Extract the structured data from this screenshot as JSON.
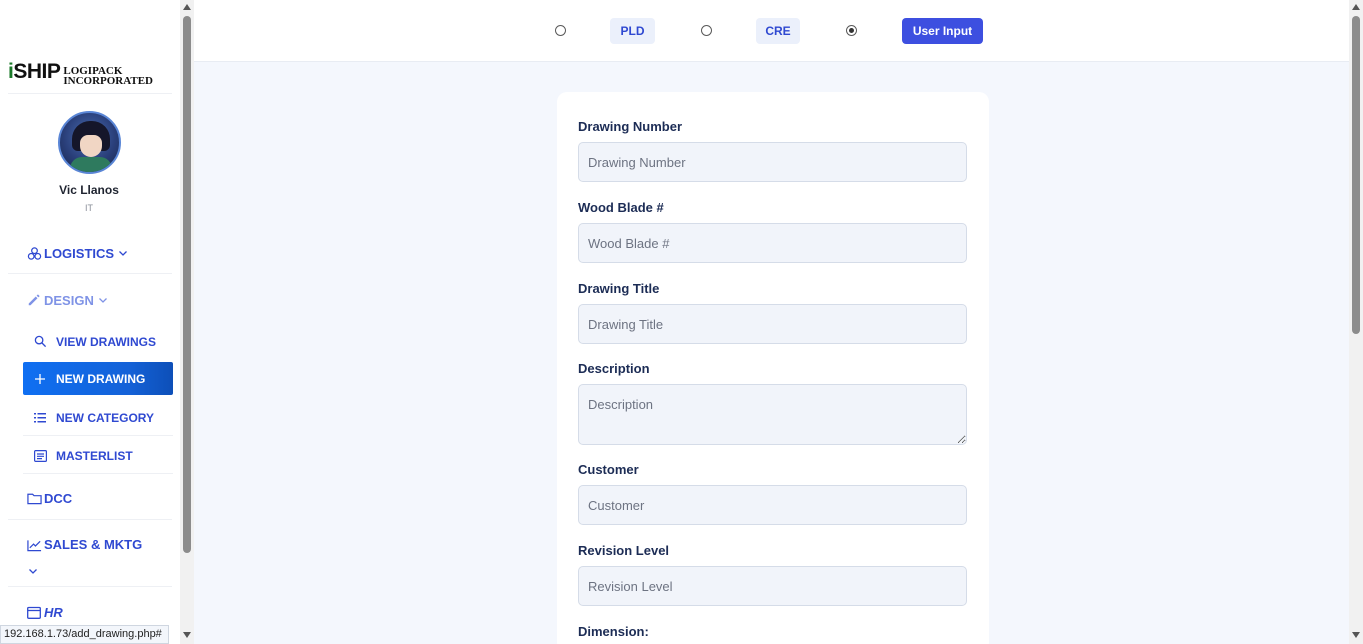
{
  "brand": {
    "logo_i": "i",
    "logo_ship": "SHIP",
    "logo_sub_line1": "LOGIPACK",
    "logo_sub_line2": "INCORPORATED"
  },
  "user": {
    "name": "Vic Llanos",
    "role": "IT"
  },
  "sidebar": {
    "sections": {
      "logistics": "LOGISTICS",
      "design": "DESIGN",
      "dcc": "DCC",
      "sales": "SALES & MKTG",
      "hr": "HR"
    },
    "design_items": [
      {
        "label": "VIEW DRAWINGS",
        "icon": "search-icon"
      },
      {
        "label": "NEW DRAWING",
        "icon": "plus-icon",
        "active": true
      },
      {
        "label": "NEW CATEGORY",
        "icon": "list-icon"
      },
      {
        "label": "MASTERLIST",
        "icon": "list-alt-icon"
      }
    ]
  },
  "status_bar": {
    "url": "192.168.1.73/add_drawing.php#"
  },
  "mode_selector": {
    "options": [
      {
        "label": "PLD",
        "selected": false
      },
      {
        "label": "CRE",
        "selected": false
      },
      {
        "label": "User Input",
        "selected": true
      }
    ]
  },
  "form": {
    "fields": [
      {
        "label": "Drawing Number",
        "placeholder": "Drawing Number"
      },
      {
        "label": "Wood Blade #",
        "placeholder": "Wood Blade #"
      },
      {
        "label": "Drawing Title",
        "placeholder": "Drawing Title"
      },
      {
        "label": "Description",
        "placeholder": "Description"
      },
      {
        "label": "Customer",
        "placeholder": "Customer"
      },
      {
        "label": "Revision Level",
        "placeholder": "Revision Level"
      },
      {
        "label": "Dimension:",
        "placeholder": ""
      }
    ]
  },
  "colors": {
    "accent": "#3d4fe0",
    "nav_text": "#2f49d1",
    "active_nav": "#0f6ff2",
    "page_bg": "#f4f7fd"
  }
}
